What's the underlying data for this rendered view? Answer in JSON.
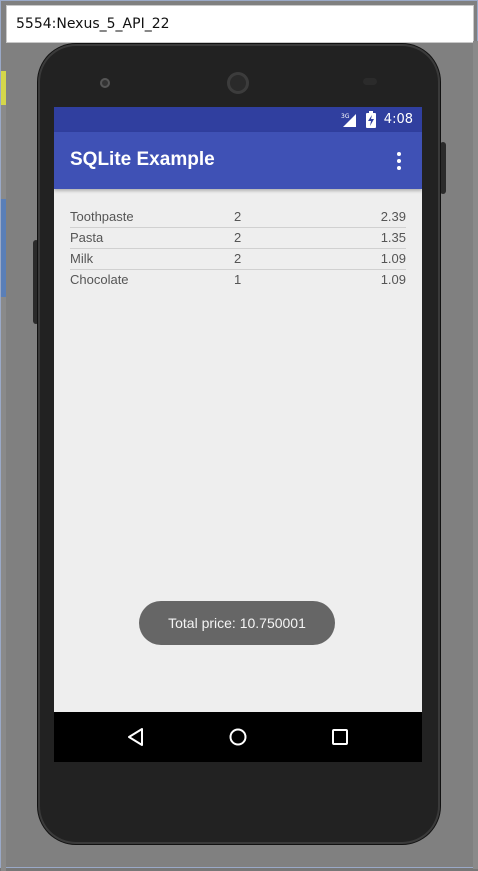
{
  "window": {
    "title": "5554:Nexus_5_API_22"
  },
  "status_bar": {
    "network": "3G",
    "time": "4:08"
  },
  "app_bar": {
    "title": "SQLite Example",
    "overflow_icon": "more-vert-icon"
  },
  "items": [
    {
      "name": "Toothpaste",
      "quantity": "2",
      "price": "2.39"
    },
    {
      "name": "Pasta",
      "quantity": "2",
      "price": "1.35"
    },
    {
      "name": "Milk",
      "quantity": "2",
      "price": "1.09"
    },
    {
      "name": "Chocolate",
      "quantity": "1",
      "price": "1.09"
    }
  ],
  "toast": {
    "text": "Total price: 10.750001"
  },
  "nav_bar": {
    "back_icon": "back-triangle-icon",
    "home_icon": "home-circle-icon",
    "recents_icon": "recents-square-icon"
  },
  "colors": {
    "status_bar": "#303f9f",
    "app_bar": "#3f51b5",
    "screen_bg": "#eeeeee",
    "toast_bg": "#666666"
  }
}
